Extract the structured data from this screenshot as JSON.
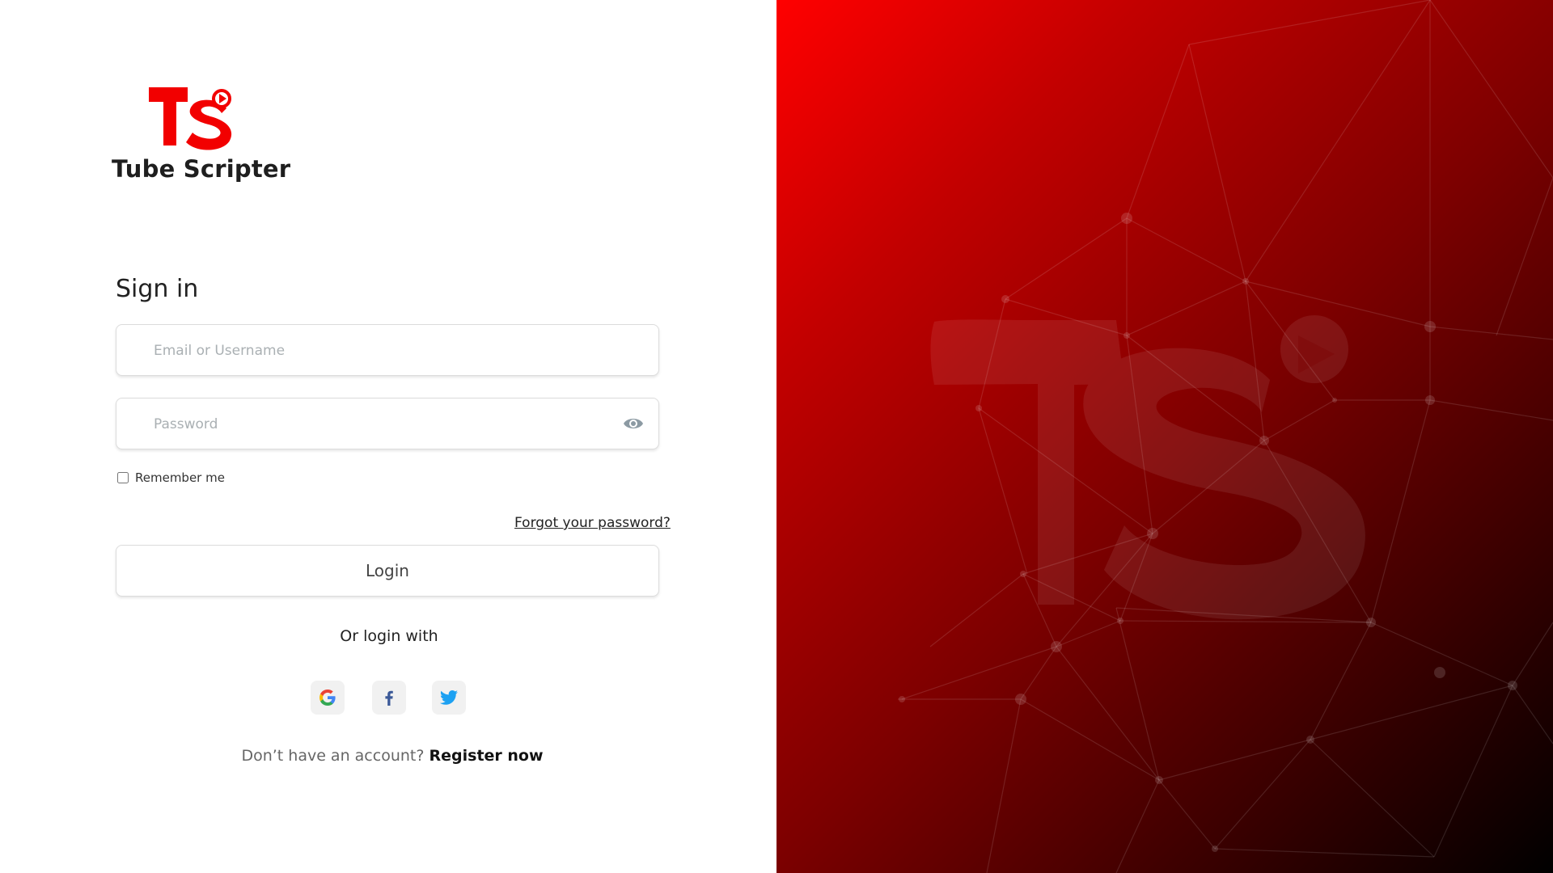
{
  "brand": {
    "name": "Tube Scripter",
    "mark_letters": "TS"
  },
  "signin": {
    "title": "Sign in",
    "email_placeholder": "Email or Username",
    "password_placeholder": "Password",
    "remember_label": "Remember me",
    "forgot_label": "Forgot your password?",
    "login_label": "Login",
    "or_login_with": "Or login with",
    "social": [
      "google-icon",
      "facebook-icon",
      "twitter-icon"
    ],
    "no_account_prompt": "Don’t have an account?",
    "register_label": "Register now"
  },
  "colors": {
    "brand_red": "#ff0000",
    "text_dark": "#222222",
    "background": "#ffffff"
  }
}
